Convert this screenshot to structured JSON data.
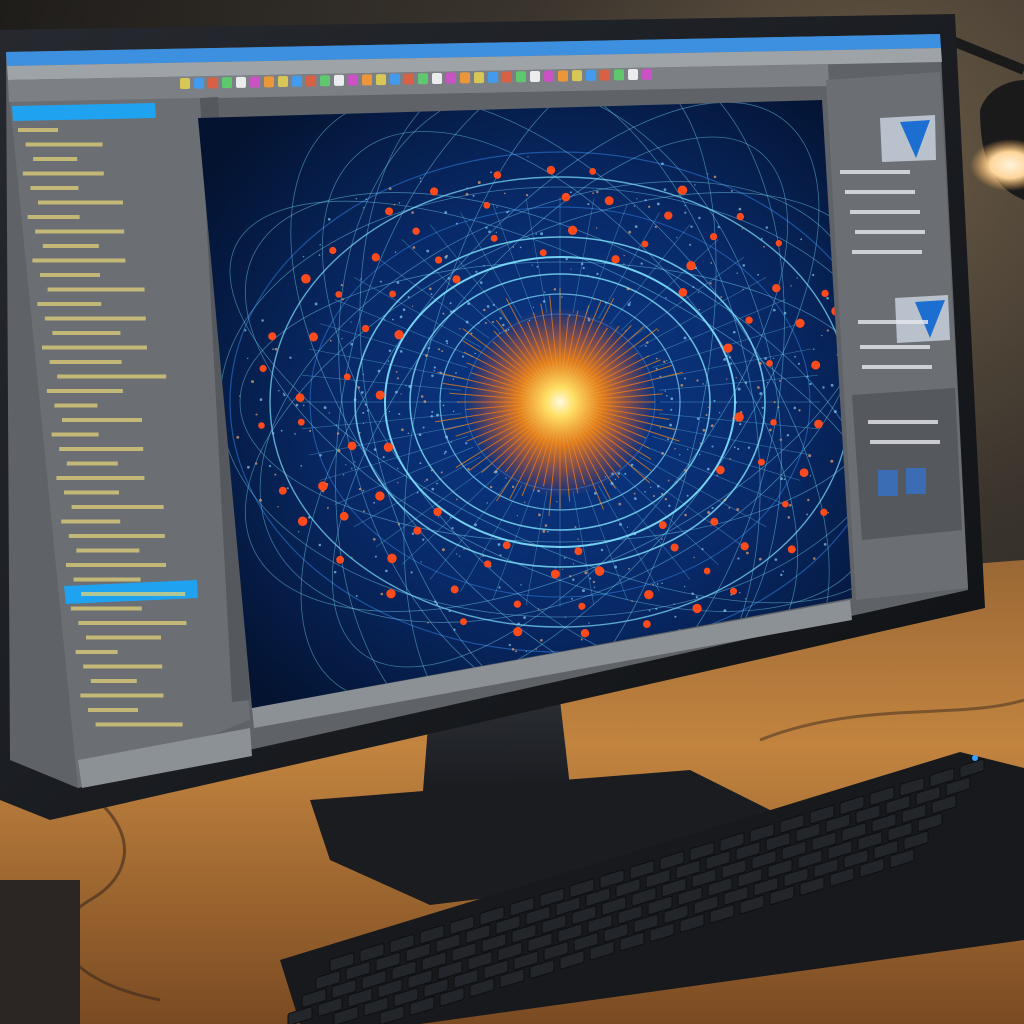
{
  "scene": {
    "description_words": [],
    "colors": {
      "background_dark": "#23211f",
      "background_warm": "#5a4632",
      "desk": "#b77a3e",
      "desk_dark": "#8a5527",
      "monitor_bezel": "#15171b",
      "monitor_stand": "#1d1f24",
      "screen_title_bar": "#3d8fe0",
      "screen_panel": "#6b6e72",
      "screen_panel_dark": "#55585c",
      "sidebar_highlight": "#1fa3f0",
      "visualization_bg": "#061a45",
      "ring_cyan": "#7fe3ff",
      "ring_blue": "#2f7fe0",
      "node_red": "#ff4a1c",
      "core_orange": "#ff8a12",
      "core_yellow": "#ffe066",
      "lamp_glow": "#ffd59a",
      "keyboard": "#17191d",
      "key": "#22252a"
    },
    "icons": [
      "desk-lamp-icon",
      "keyboard-icon",
      "monitor-icon"
    ]
  }
}
